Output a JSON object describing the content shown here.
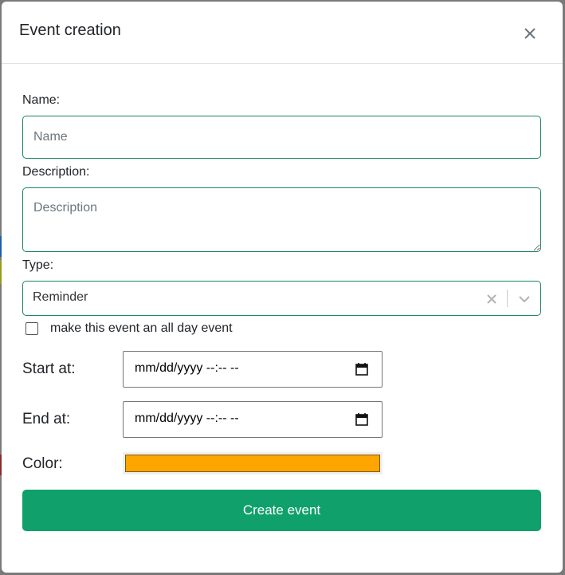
{
  "modal": {
    "title": "Event creation"
  },
  "form": {
    "name": {
      "label": "Name:",
      "placeholder": "Name",
      "value": ""
    },
    "description": {
      "label": "Description:",
      "placeholder": "Description",
      "value": ""
    },
    "type": {
      "label": "Type:",
      "selected": "Reminder"
    },
    "all_day": {
      "label": "make this event an all day event",
      "checked": false
    },
    "start": {
      "label": "Start at:",
      "value": "mm/dd/yyyy --:-- --"
    },
    "end": {
      "label": "End at:",
      "value": "mm/dd/yyyy --:-- --"
    },
    "color": {
      "label": "Color:",
      "value": "#FFA500"
    },
    "submit_label": "Create event"
  },
  "colors": {
    "accent_border": "#19875b",
    "submit_bg": "#10a06b",
    "backdrop": "#7a7a7a"
  },
  "icons": {
    "close": "close-icon",
    "clear": "clear-icon",
    "dropdown": "chevron-down-icon",
    "calendar": "calendar-icon"
  }
}
